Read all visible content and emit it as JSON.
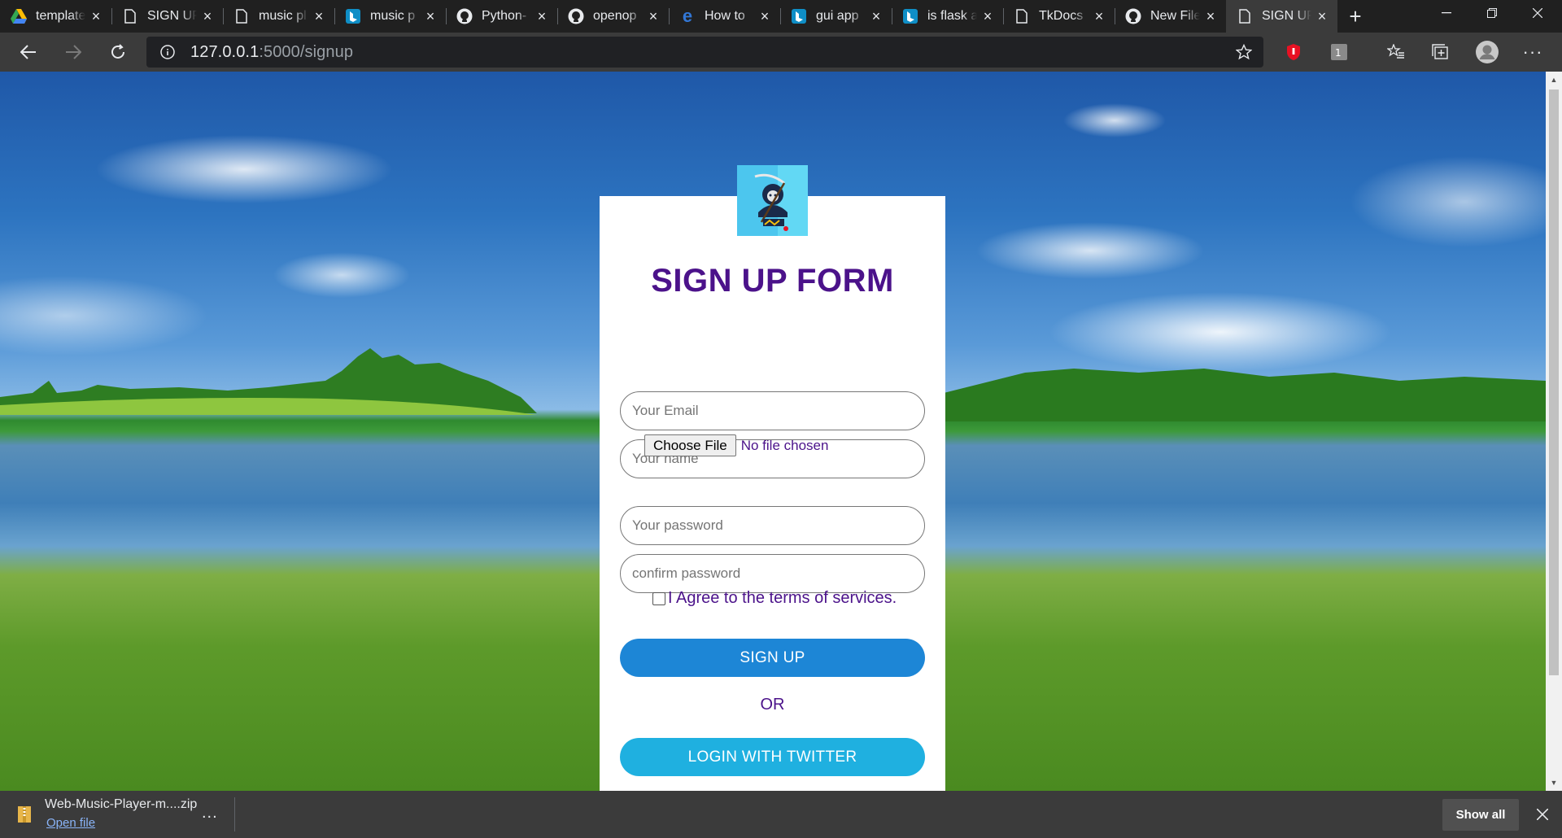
{
  "tabs": [
    {
      "title": "template",
      "icon": "google-drive-icon"
    },
    {
      "title": "SIGN UP",
      "icon": "page-icon"
    },
    {
      "title": "music pl",
      "icon": "page-icon"
    },
    {
      "title": "music p",
      "icon": "bing-icon"
    },
    {
      "title": "Python-",
      "icon": "github-icon"
    },
    {
      "title": "openop",
      "icon": "github-icon"
    },
    {
      "title": "How to",
      "icon": "edge-icon"
    },
    {
      "title": "gui app",
      "icon": "bing-icon"
    },
    {
      "title": "is flask a",
      "icon": "bing-icon"
    },
    {
      "title": "TkDocs",
      "icon": "page-icon"
    },
    {
      "title": "New File",
      "icon": "github-icon"
    },
    {
      "title": "SIGN UP",
      "icon": "page-icon",
      "active": true
    }
  ],
  "address_bar": {
    "host": "127.0.0.1",
    "path": ":5000/signup"
  },
  "form": {
    "title": "SIGN UP FORM",
    "email_placeholder": "Your Email",
    "name_placeholder": "Your name",
    "file_button": "Choose File",
    "file_status": "No file chosen",
    "password_placeholder": "Your password",
    "confirm_placeholder": "confirm password",
    "agree_text": "I Agree to the terms of services.",
    "signup_label": "SIGN UP",
    "or_text": "OR",
    "twitter_label": "LOGIN WITH TWITTER"
  },
  "download": {
    "file_name": "Web-Music-Player-m....zip",
    "open_label": "Open file",
    "more_label": "...",
    "show_all_label": "Show all"
  },
  "colors": {
    "title": "#4b128a",
    "signup_button": "#1d86d6",
    "twitter_button": "#1fb0e0"
  }
}
